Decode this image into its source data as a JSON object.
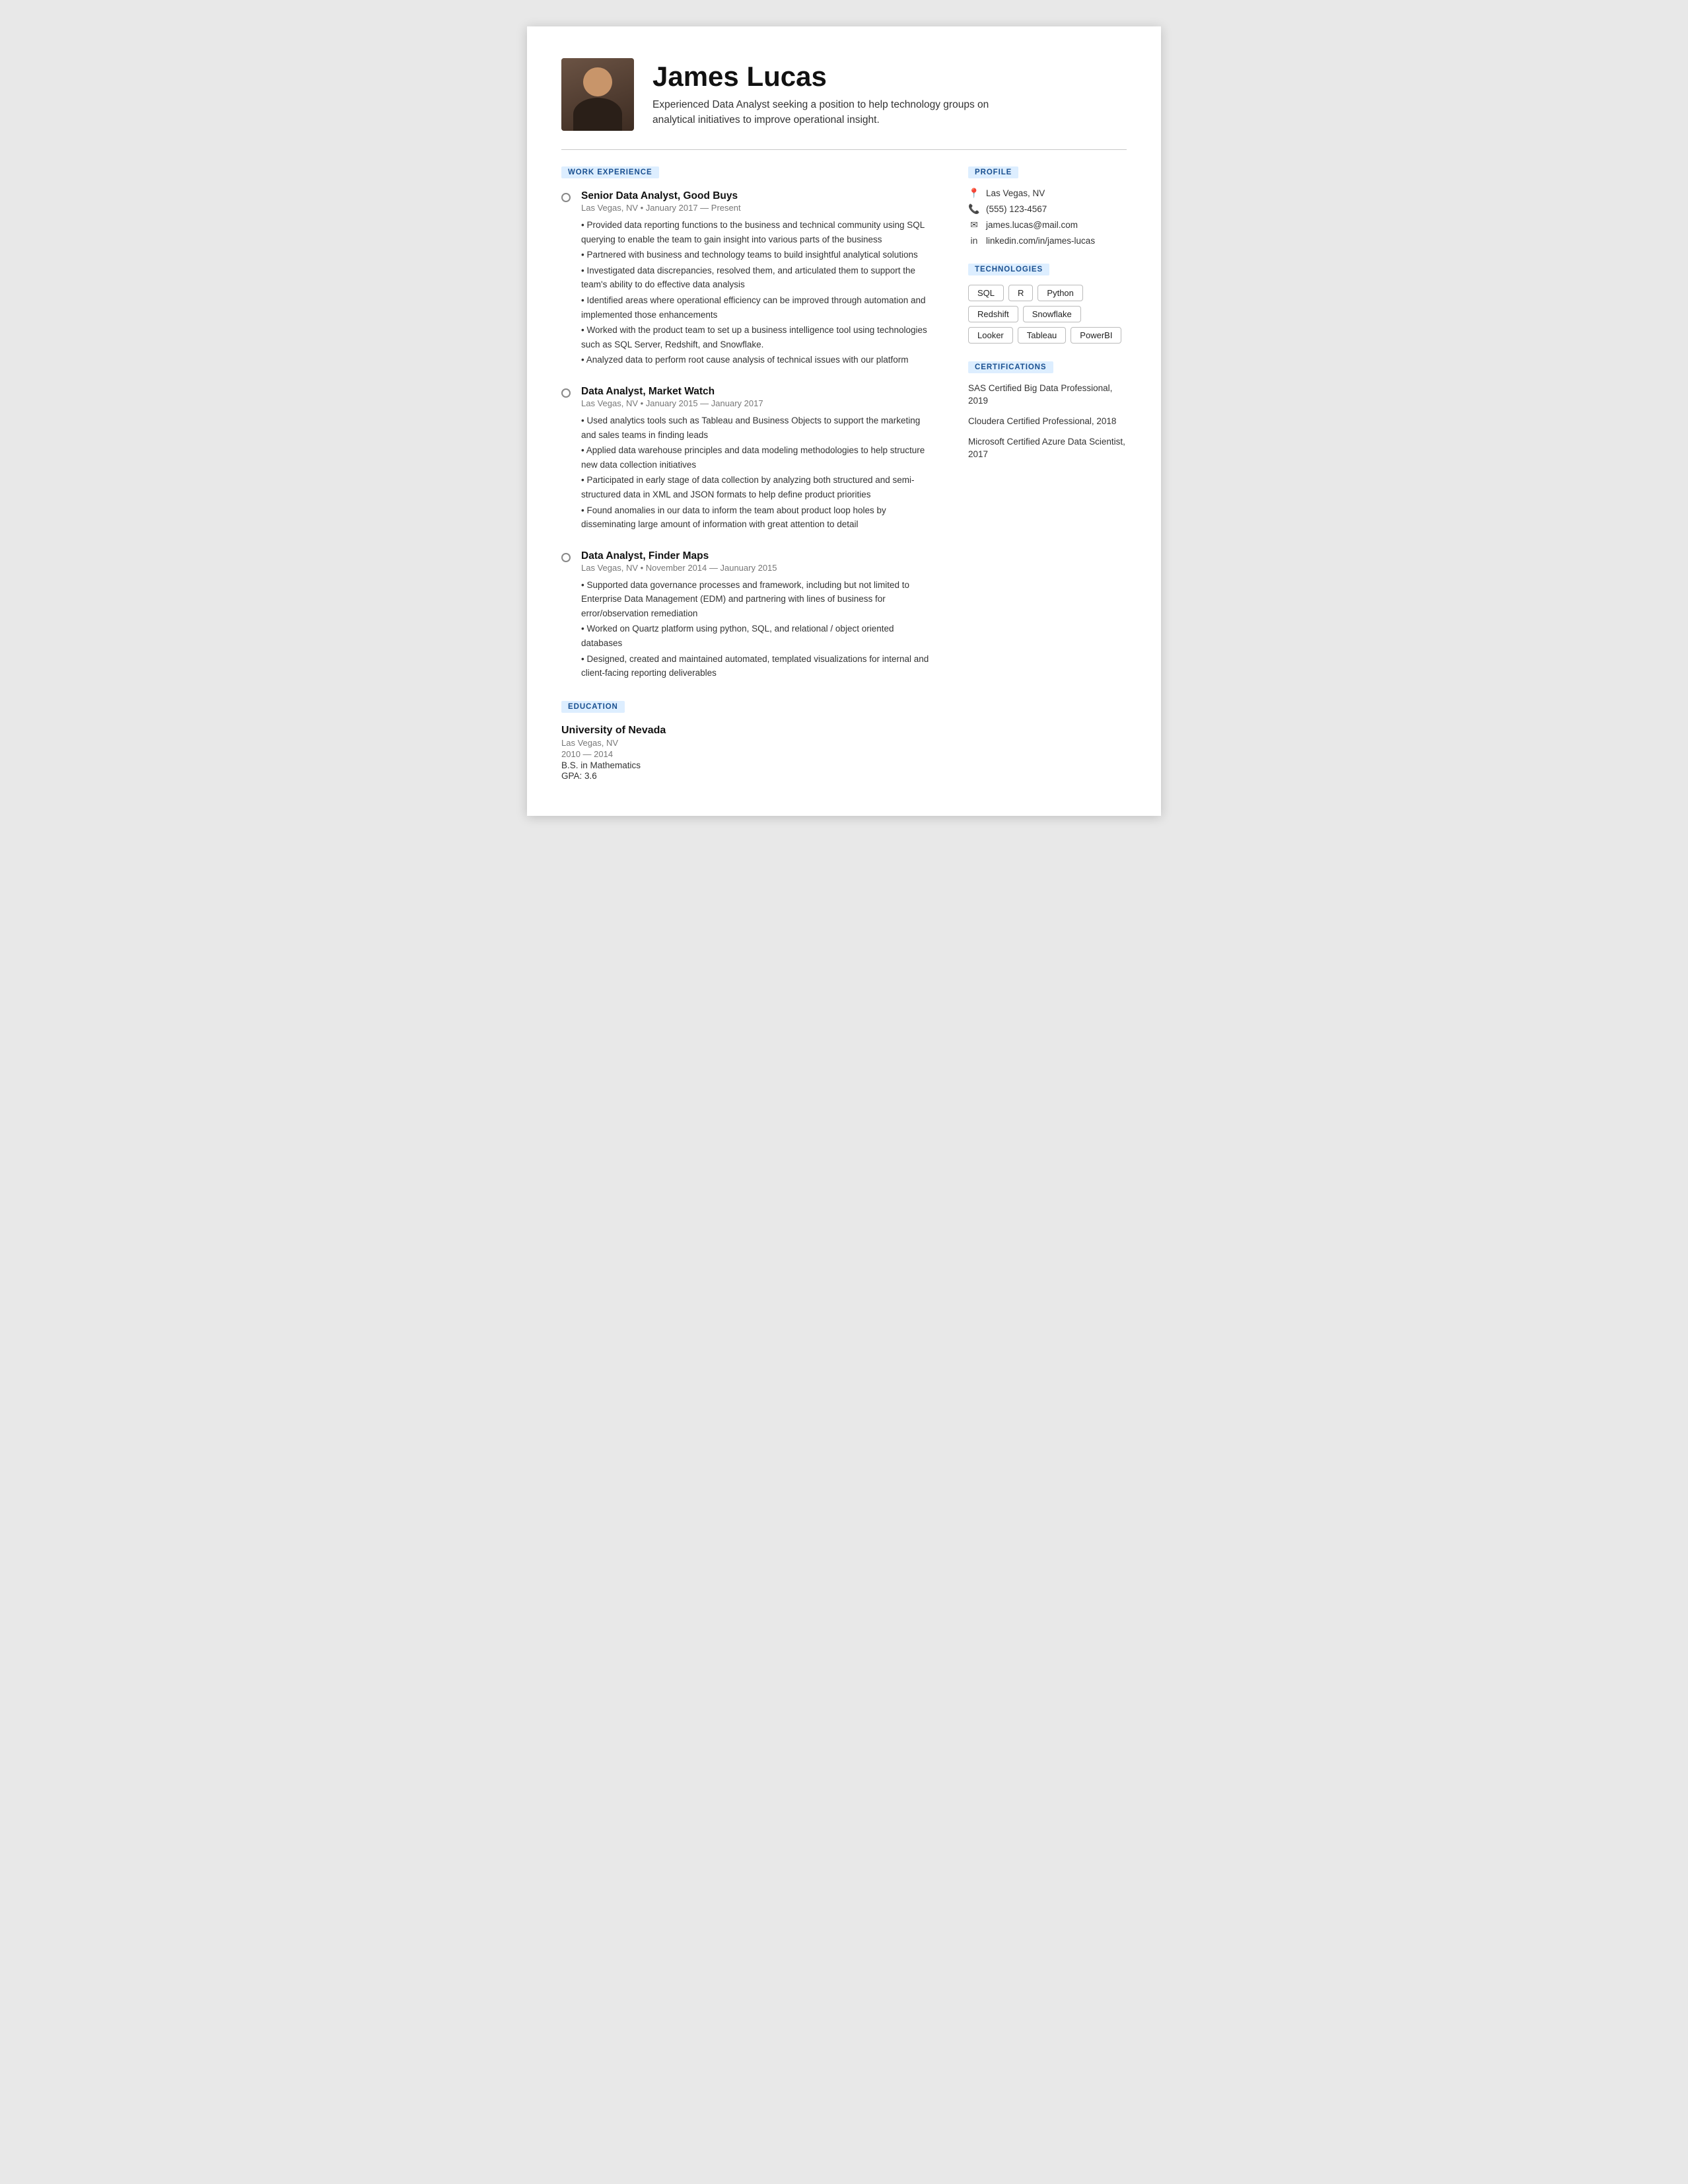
{
  "header": {
    "name": "James Lucas",
    "tagline": "Experienced Data Analyst seeking a position to help technology groups on analytical initiatives to improve operational insight."
  },
  "sections": {
    "work_experience_label": "WORK EXPERIENCE",
    "education_label": "EDUCATION",
    "profile_label": "PROFILE",
    "technologies_label": "TECHNOLOGIES",
    "certifications_label": "CERTIFICATIONS"
  },
  "jobs": [
    {
      "title": "Senior Data Analyst, Good Buys",
      "meta": "Las Vegas, NV • January 2017 — Present",
      "bullets": [
        "• Provided data reporting functions to the business and technical community using SQL querying to enable the team to gain insight into various parts of the business",
        "• Partnered with business and technology teams to build insightful analytical solutions",
        "• Investigated data discrepancies, resolved them, and articulated them to support the team's ability to do effective data analysis",
        "• Identified areas where operational efficiency can be improved through automation and implemented those enhancements",
        "• Worked with the product team to set up a business intelligence tool using technologies such as SQL Server, Redshift, and Snowflake.",
        "• Analyzed data to perform root cause analysis of technical issues with our platform"
      ]
    },
    {
      "title": "Data Analyst, Market Watch",
      "meta": "Las Vegas, NV • January 2015 — January 2017",
      "bullets": [
        "• Used analytics tools such as Tableau and Business Objects to support the marketing and sales teams in finding leads",
        "• Applied data warehouse principles and data modeling methodologies to help structure new data collection initiatives",
        "• Participated in early stage of data collection by analyzing both structured and semi-structured data in XML and JSON formats to help define product priorities",
        "• Found anomalies in our data to inform the team about product loop holes by disseminating large amount of information with great attention to detail"
      ]
    },
    {
      "title": "Data Analyst, Finder Maps",
      "meta": "Las Vegas, NV • November 2014 — Jaunuary 2015",
      "bullets": [
        "• Supported data governance processes and framework, including but not limited to Enterprise Data Management (EDM) and partnering with lines of business for error/observation remediation",
        "• Worked on Quartz platform using python, SQL, and relational / object oriented databases",
        "• Designed, created and maintained automated, templated visualizations for internal and client-facing reporting deliverables"
      ]
    }
  ],
  "education": {
    "school": "University of Nevada",
    "location": "Las Vegas, NV",
    "years": "2010 — 2014",
    "degree": "B.S. in Mathematics",
    "gpa": "GPA: 3.6"
  },
  "profile": {
    "location": "Las Vegas, NV",
    "phone": "(555) 123-4567",
    "email": "james.lucas@mail.com",
    "linkedin": "linkedin.com/in/james-lucas"
  },
  "technologies": [
    "SQL",
    "R",
    "Python",
    "Redshift",
    "Snowflake",
    "Looker",
    "Tableau",
    "PowerBI"
  ],
  "certifications": [
    "SAS Certified Big Data Professional, 2019",
    "Cloudera Certified Professional, 2018",
    "Microsoft Certified Azure Data Scientist, 2017"
  ]
}
